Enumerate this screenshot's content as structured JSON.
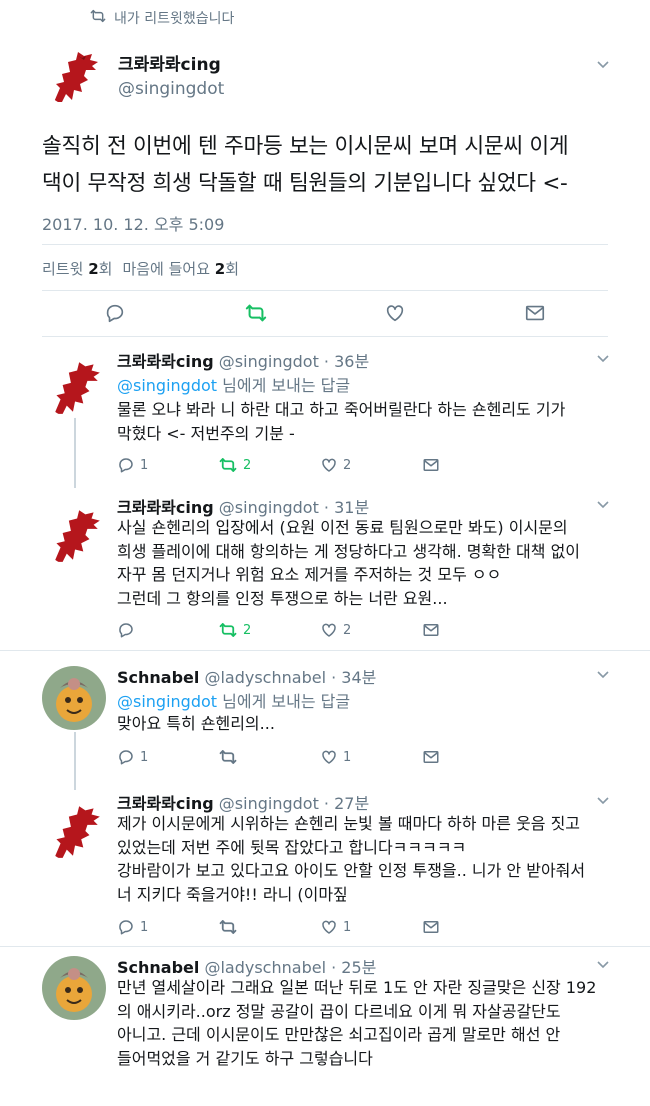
{
  "retweet_context": {
    "label": "내가 리트윗했습니다"
  },
  "main_tweet": {
    "name": "크롸롸롸cing",
    "handle": "@singingdot",
    "text_line1": "솔직히 전 이번에 텐 주마등 보는 이시문씨 보며 시문씨 이게",
    "text_line2": "댁이 무작정 희생 닥돌할 때 팀원들의 기분입니다 싶었다 <-",
    "timestamp": "2017. 10. 12. 오후 5:09",
    "retweets_label": "리트윗",
    "retweets_count": "2",
    "retweets_unit": "회",
    "likes_label": "마음에 들어요",
    "likes_count": "2",
    "likes_unit": "회"
  },
  "replies": [
    {
      "name": "크롸롸롸cing",
      "meta": "@singingdot · 36분",
      "to_mention": "@singingdot",
      "to_suffix": " 님에게 보내는 답글",
      "lines": [
        "물론 오냐 봐라 니 하란 대고 하고 죽어버릴란다 하는 숀헨리도 기가",
        "막혔다 <- 저번주의 기분 -"
      ],
      "reply_count": "1",
      "retweet_count": "2",
      "like_count": "2"
    },
    {
      "name": "크롸롸롸cing",
      "meta": "@singingdot · 31분",
      "lines": [
        "사실 숀헨리의 입장에서 (요원 이전 동료 팀원으로만 봐도) 이시문의",
        "희생 플레이에 대해 항의하는 게 정당하다고 생각해. 명확한 대책 없이",
        "자꾸 몸 던지거나 위험 요소 제거를 주저하는 것 모두 ㅇㅇ",
        "그런데 그 항의를 인정 투쟁으로 하는 너란 요원..."
      ],
      "reply_count": "",
      "retweet_count": "2",
      "like_count": "2"
    },
    {
      "name": "Schnabel",
      "meta": "@ladyschnabel · 34분",
      "to_mention": "@singingdot",
      "to_suffix": " 님에게 보내는 답글",
      "lines": [
        "맞아요 특히 숀헨리의..."
      ],
      "reply_count": "1",
      "retweet_count": "",
      "like_count": "1"
    },
    {
      "name": "크롸롸롸cing",
      "meta": "@singingdot · 27분",
      "lines": [
        "제가 이시문에게 시위하는 숀헨리 눈빛 볼 때마다 하하 마른 웃음 짓고",
        "있었는데 저번 주에 뒷목 잡았다고 합니다ㅋㅋㅋㅋㅋ",
        "강바람이가 보고 있다고요 아이도 안할 인정 투쟁을.. 니가 안 받아줘서",
        "너 지키다 죽을거야!! 라니 (이마짚"
      ],
      "reply_count": "1",
      "retweet_count": "",
      "like_count": "1"
    },
    {
      "name": "Schnabel",
      "meta": "@ladyschnabel · 25분",
      "lines": [
        "만년 열세살이라 그래요 일본 떠난 뒤로 1도 안 자란 징글맞은 신장 192",
        "의 애시키라..orz 정말 공갈이 끕이 다르네요 이게 뭐 자살공갈단도",
        "아니고. 근데 이시문이도 만만찮은 쇠고집이라 곱게 말로만 해선 안",
        "들어먹었을 거 같기도 하구 그렇습니다"
      ]
    }
  ],
  "colors": {
    "link": "#1da1f2",
    "retweet_green": "#17bf63",
    "muted": "#657786",
    "divider": "#e1e8ed"
  },
  "icons": [
    "retweet-icon",
    "reply-icon",
    "like-icon",
    "message-icon",
    "chevron-down-icon"
  ]
}
